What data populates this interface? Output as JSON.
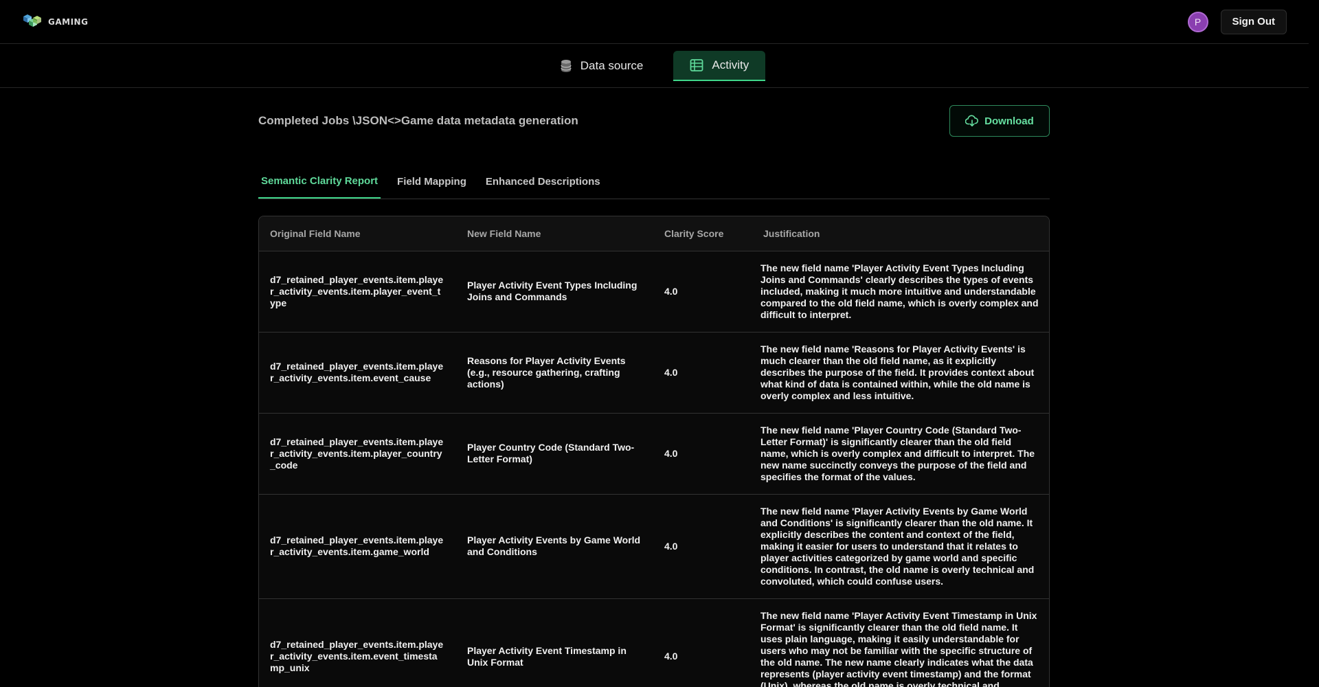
{
  "brand": {
    "name": "GAMING",
    "logo": "cube-logo-icon"
  },
  "user": {
    "initial": "P",
    "signout_label": "Sign Out"
  },
  "nav": {
    "tabs": [
      {
        "label": "Data source",
        "icon": "database-icon",
        "active": false
      },
      {
        "label": "Activity",
        "icon": "table-list-icon",
        "active": true
      }
    ]
  },
  "page": {
    "breadcrumb": "Completed Jobs \\JSON<>Game data metadata generation",
    "download_label": "Download"
  },
  "subtabs": [
    {
      "label": "Semantic Clarity Report",
      "active": true
    },
    {
      "label": "Field Mapping",
      "active": false
    },
    {
      "label": "Enhanced Descriptions",
      "active": false
    }
  ],
  "table": {
    "headers": [
      "Original Field Name",
      "New Field Name",
      "Clarity Score",
      "Justification"
    ],
    "rows": [
      {
        "original": "d7_retained_player_events.item.player_activity_events.item.player_event_type",
        "new_name": "Player Activity Event Types Including Joins and Commands",
        "score": "4.0",
        "justification": "The new field name 'Player Activity Event Types Including Joins and Commands' clearly describes the types of events included, making it much more intuitive and understandable compared to the old field name, which is overly complex and difficult to interpret."
      },
      {
        "original": "d7_retained_player_events.item.player_activity_events.item.event_cause",
        "new_name": "Reasons for Player Activity Events (e.g., resource gathering, crafting actions)",
        "score": "4.0",
        "justification": "The new field name 'Reasons for Player Activity Events' is much clearer than the old field name, as it explicitly describes the purpose of the field. It provides context about what kind of data is contained within, while the old name is overly complex and less intuitive."
      },
      {
        "original": "d7_retained_player_events.item.player_activity_events.item.player_country_code",
        "new_name": "Player Country Code (Standard Two-Letter Format)",
        "score": "4.0",
        "justification": "The new field name 'Player Country Code (Standard Two-Letter Format)' is significantly clearer than the old field name, which is overly complex and difficult to interpret. The new name succinctly conveys the purpose of the field and specifies the format of the values."
      },
      {
        "original": "d7_retained_player_events.item.player_activity_events.item.game_world",
        "new_name": "Player Activity Events by Game World and Conditions",
        "score": "4.0",
        "justification": "The new field name 'Player Activity Events by Game World and Conditions' is significantly clearer than the old name. It explicitly describes the content and context of the field, making it easier for users to understand that it relates to player activities categorized by game world and specific conditions. In contrast, the old name is overly technical and convoluted, which could confuse users."
      },
      {
        "original": "d7_retained_player_events.item.player_activity_events.item.event_timestamp_unix",
        "new_name": "Player Activity Event Timestamp in Unix Format",
        "score": "4.0",
        "justification": "The new field name 'Player Activity Event Timestamp in Unix Format' is significantly clearer than the old field name. It uses plain language, making it easily understandable for users who may not be familiar with the specific structure of the old name. The new name clearly indicates what the data represents (player activity event timestamp) and the format (Unix), whereas the old name is overly technical and convoluted."
      }
    ]
  },
  "colors": {
    "accent": "#3fd68a",
    "avatar": "#8a3fb0",
    "background": "#000000"
  }
}
